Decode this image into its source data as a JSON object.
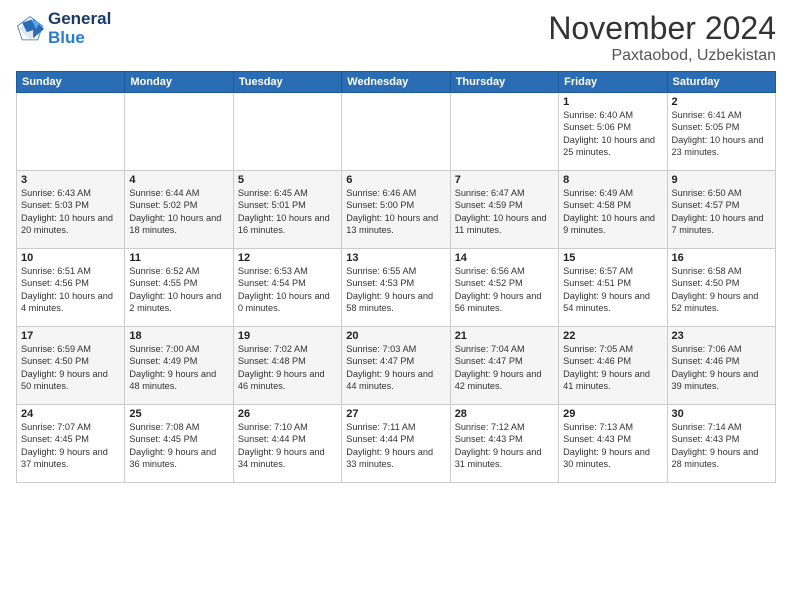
{
  "header": {
    "logo_line1": "General",
    "logo_line2": "Blue",
    "month": "November 2024",
    "location": "Paxtaobod, Uzbekistan"
  },
  "days_of_week": [
    "Sunday",
    "Monday",
    "Tuesday",
    "Wednesday",
    "Thursday",
    "Friday",
    "Saturday"
  ],
  "weeks": [
    [
      {
        "day": "",
        "info": ""
      },
      {
        "day": "",
        "info": ""
      },
      {
        "day": "",
        "info": ""
      },
      {
        "day": "",
        "info": ""
      },
      {
        "day": "",
        "info": ""
      },
      {
        "day": "1",
        "info": "Sunrise: 6:40 AM\nSunset: 5:06 PM\nDaylight: 10 hours and 25 minutes."
      },
      {
        "day": "2",
        "info": "Sunrise: 6:41 AM\nSunset: 5:05 PM\nDaylight: 10 hours and 23 minutes."
      }
    ],
    [
      {
        "day": "3",
        "info": "Sunrise: 6:43 AM\nSunset: 5:03 PM\nDaylight: 10 hours and 20 minutes."
      },
      {
        "day": "4",
        "info": "Sunrise: 6:44 AM\nSunset: 5:02 PM\nDaylight: 10 hours and 18 minutes."
      },
      {
        "day": "5",
        "info": "Sunrise: 6:45 AM\nSunset: 5:01 PM\nDaylight: 10 hours and 16 minutes."
      },
      {
        "day": "6",
        "info": "Sunrise: 6:46 AM\nSunset: 5:00 PM\nDaylight: 10 hours and 13 minutes."
      },
      {
        "day": "7",
        "info": "Sunrise: 6:47 AM\nSunset: 4:59 PM\nDaylight: 10 hours and 11 minutes."
      },
      {
        "day": "8",
        "info": "Sunrise: 6:49 AM\nSunset: 4:58 PM\nDaylight: 10 hours and 9 minutes."
      },
      {
        "day": "9",
        "info": "Sunrise: 6:50 AM\nSunset: 4:57 PM\nDaylight: 10 hours and 7 minutes."
      }
    ],
    [
      {
        "day": "10",
        "info": "Sunrise: 6:51 AM\nSunset: 4:56 PM\nDaylight: 10 hours and 4 minutes."
      },
      {
        "day": "11",
        "info": "Sunrise: 6:52 AM\nSunset: 4:55 PM\nDaylight: 10 hours and 2 minutes."
      },
      {
        "day": "12",
        "info": "Sunrise: 6:53 AM\nSunset: 4:54 PM\nDaylight: 10 hours and 0 minutes."
      },
      {
        "day": "13",
        "info": "Sunrise: 6:55 AM\nSunset: 4:53 PM\nDaylight: 9 hours and 58 minutes."
      },
      {
        "day": "14",
        "info": "Sunrise: 6:56 AM\nSunset: 4:52 PM\nDaylight: 9 hours and 56 minutes."
      },
      {
        "day": "15",
        "info": "Sunrise: 6:57 AM\nSunset: 4:51 PM\nDaylight: 9 hours and 54 minutes."
      },
      {
        "day": "16",
        "info": "Sunrise: 6:58 AM\nSunset: 4:50 PM\nDaylight: 9 hours and 52 minutes."
      }
    ],
    [
      {
        "day": "17",
        "info": "Sunrise: 6:59 AM\nSunset: 4:50 PM\nDaylight: 9 hours and 50 minutes."
      },
      {
        "day": "18",
        "info": "Sunrise: 7:00 AM\nSunset: 4:49 PM\nDaylight: 9 hours and 48 minutes."
      },
      {
        "day": "19",
        "info": "Sunrise: 7:02 AM\nSunset: 4:48 PM\nDaylight: 9 hours and 46 minutes."
      },
      {
        "day": "20",
        "info": "Sunrise: 7:03 AM\nSunset: 4:47 PM\nDaylight: 9 hours and 44 minutes."
      },
      {
        "day": "21",
        "info": "Sunrise: 7:04 AM\nSunset: 4:47 PM\nDaylight: 9 hours and 42 minutes."
      },
      {
        "day": "22",
        "info": "Sunrise: 7:05 AM\nSunset: 4:46 PM\nDaylight: 9 hours and 41 minutes."
      },
      {
        "day": "23",
        "info": "Sunrise: 7:06 AM\nSunset: 4:46 PM\nDaylight: 9 hours and 39 minutes."
      }
    ],
    [
      {
        "day": "24",
        "info": "Sunrise: 7:07 AM\nSunset: 4:45 PM\nDaylight: 9 hours and 37 minutes."
      },
      {
        "day": "25",
        "info": "Sunrise: 7:08 AM\nSunset: 4:45 PM\nDaylight: 9 hours and 36 minutes."
      },
      {
        "day": "26",
        "info": "Sunrise: 7:10 AM\nSunset: 4:44 PM\nDaylight: 9 hours and 34 minutes."
      },
      {
        "day": "27",
        "info": "Sunrise: 7:11 AM\nSunset: 4:44 PM\nDaylight: 9 hours and 33 minutes."
      },
      {
        "day": "28",
        "info": "Sunrise: 7:12 AM\nSunset: 4:43 PM\nDaylight: 9 hours and 31 minutes."
      },
      {
        "day": "29",
        "info": "Sunrise: 7:13 AM\nSunset: 4:43 PM\nDaylight: 9 hours and 30 minutes."
      },
      {
        "day": "30",
        "info": "Sunrise: 7:14 AM\nSunset: 4:43 PM\nDaylight: 9 hours and 28 minutes."
      }
    ]
  ]
}
